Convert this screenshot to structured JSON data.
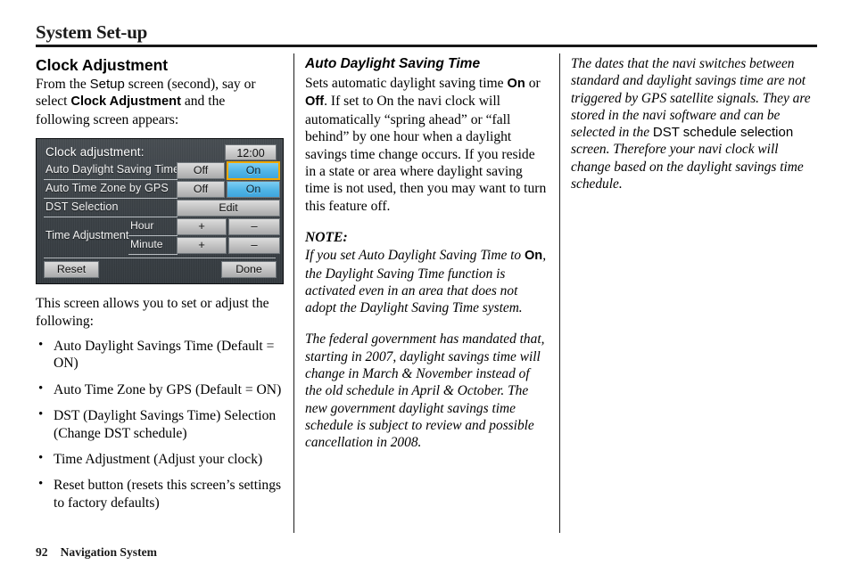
{
  "header": {
    "title": "System Set-up"
  },
  "left_column": {
    "heading": "Clock Adjustment",
    "intro_1": "From the ",
    "intro_setup": "Setup",
    "intro_2": " screen (second), say or select ",
    "intro_clock_adjustment": "Clock Adjustment",
    "intro_3": " and the following screen appears:",
    "navi_screen": {
      "title": "Clock adjustment:",
      "clock": "12:00",
      "rows": [
        {
          "label": "Auto Daylight Saving Time",
          "off": "Off",
          "on": "On"
        },
        {
          "label": "Auto Time Zone by GPS",
          "off": "Off",
          "on": "On"
        },
        {
          "label": "DST Selection",
          "edit": "Edit"
        }
      ],
      "time_adjustment": {
        "label": "Time Adjustment",
        "hour": "Hour",
        "minute": "Minute",
        "plus": "+",
        "minus": "–"
      },
      "reset": "Reset",
      "done": "Done",
      "selected_color": "#f0a800",
      "on_color": "#4fb4e6"
    },
    "after_image": "This screen allows you to set or adjust the following:",
    "bullets": [
      "Auto Daylight Savings Time  (Default = ON)",
      "Auto Time Zone by GPS (Default = ON)",
      "DST (Daylight Savings Time) Selection (Change DST schedule)",
      "Time Adjustment (Adjust your clock)",
      "Reset button (resets this screen’s settings to factory defaults)"
    ]
  },
  "middle_column": {
    "heading": "Auto Daylight Saving Time",
    "para_1a": "Sets automatic daylight saving time ",
    "para_1_on": "On",
    "para_1b": " or ",
    "para_1_off": "Off",
    "para_1c": ". If set to On the navi clock will automatically “spring ahead” or “fall behind” by one hour when a daylight savings time change occurs. If you reside in a state or area where daylight saving time is not used, then you may want to turn this feature off.",
    "note_label": "NOTE:",
    "note_a": "If you set Auto Daylight Saving Time to ",
    "note_on": "On",
    "note_b": ", the Daylight Saving Time function is activated even in an area that does not adopt the Daylight Saving Time system.",
    "para_2": "The federal government has mandated that, starting in 2007, daylight savings time will change in March & November instead of the old schedule in April & October. The new government daylight savings time schedule is subject to review and possible cancellation in 2008."
  },
  "right_column": {
    "para_a": "The dates that the navi switches between standard and daylight savings time are not triggered by GPS satellite signals. They are stored in the navi software and can be selected in the ",
    "para_dst": "DST schedule selection",
    "para_b": " screen. Therefore your navi clock will change based on the daylight savings time schedule."
  },
  "footer": {
    "page_number": "92",
    "label": "Navigation System"
  }
}
